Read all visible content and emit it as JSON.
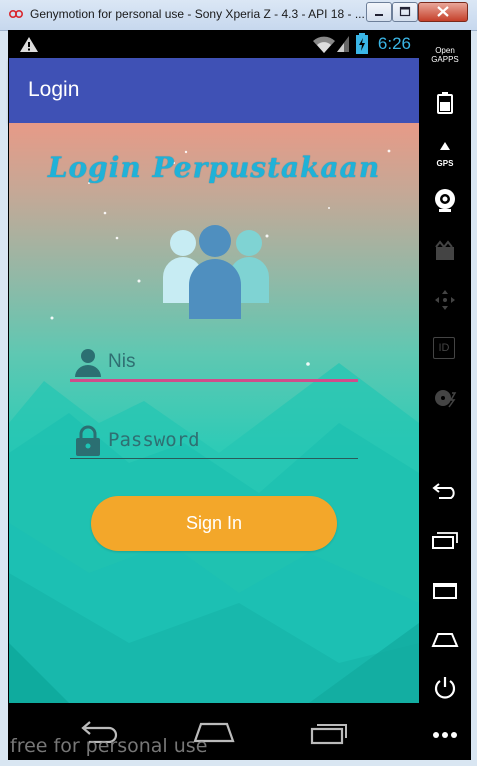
{
  "window": {
    "title": "Genymotion for personal use - Sony Xperia Z - 4.3 - API 18 - ..."
  },
  "statusbar": {
    "time": "6:26"
  },
  "actionbar": {
    "title": "Login"
  },
  "login": {
    "headline": "Login Perpustakaan",
    "nis_placeholder": "Nis",
    "password_placeholder": "Password",
    "signin_label": "Sign In"
  },
  "sidebar": {
    "opengapps_line1": "Open",
    "opengapps_line2": "GAPPS",
    "gps_label": "GPS",
    "id_label": "ID"
  },
  "watermark": "free for personal use",
  "colors": {
    "actionbar": "#3f51b5",
    "signin": "#f3a72a",
    "accent_underline": "#d14c8b",
    "clock": "#3ab6e6"
  }
}
